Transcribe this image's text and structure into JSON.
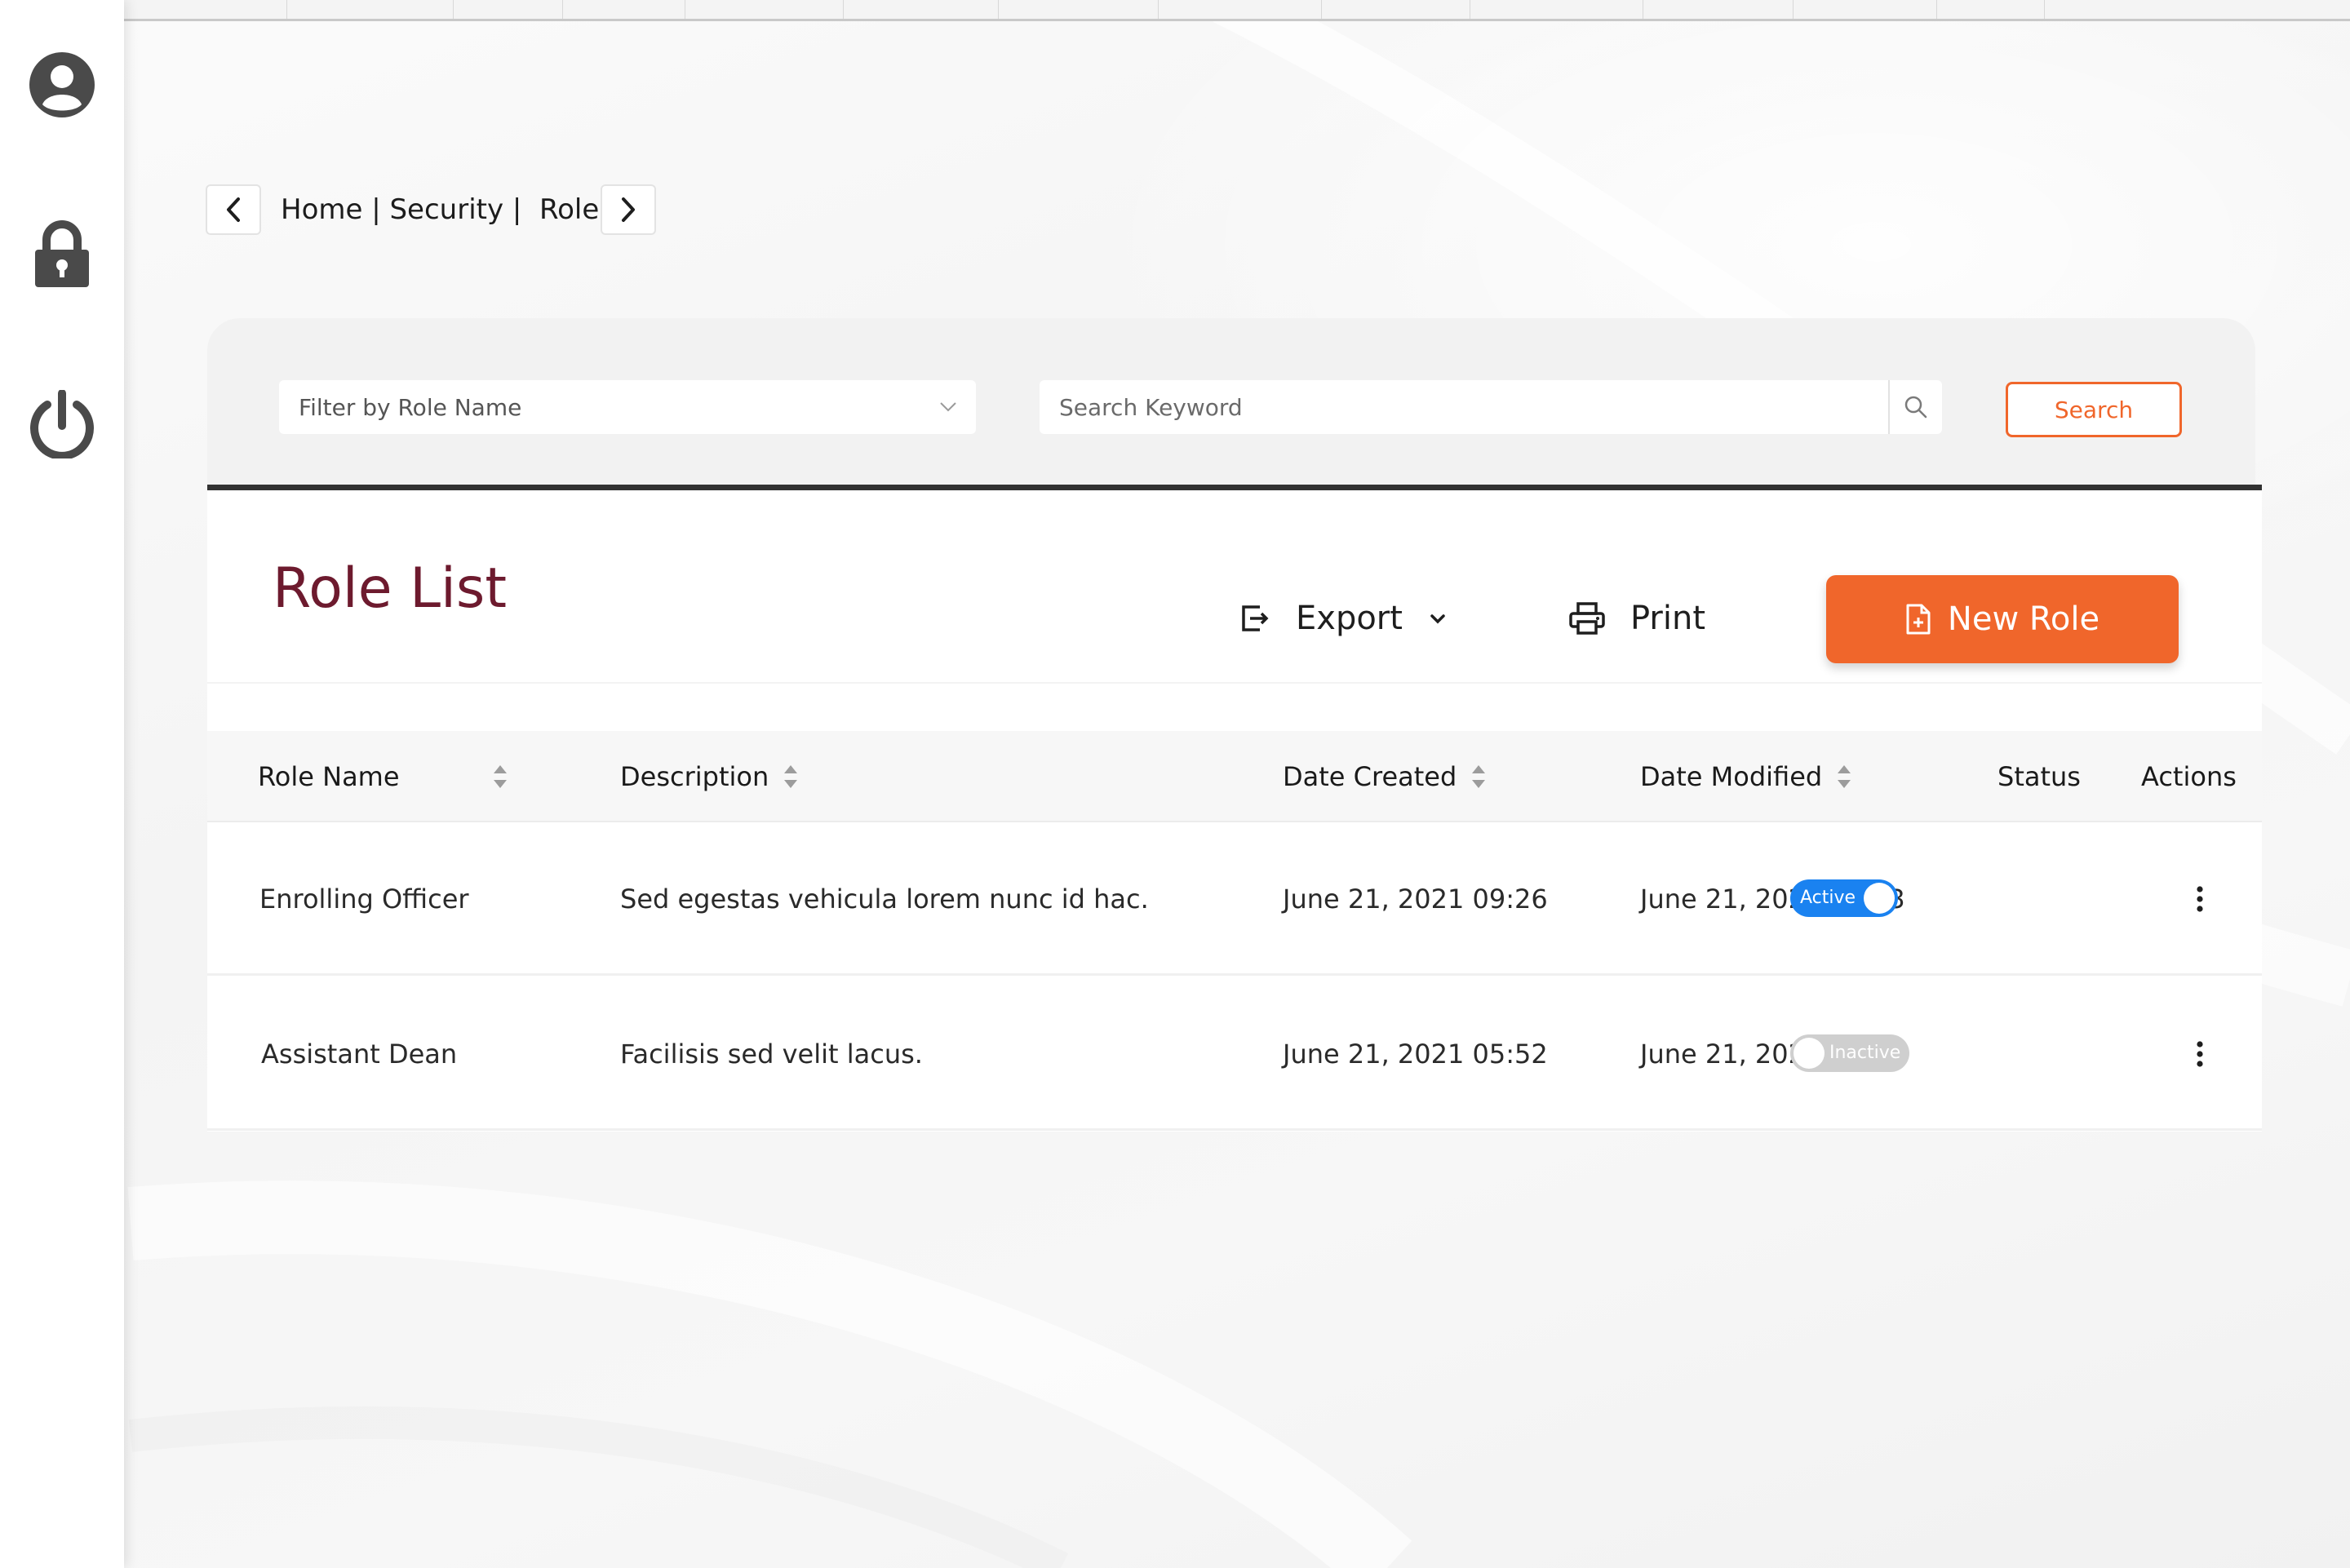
{
  "sidebar": {
    "items": [
      {
        "icon": "user-circle-icon"
      },
      {
        "icon": "lock-icon"
      },
      {
        "icon": "power-icon"
      }
    ]
  },
  "breadcrumb": {
    "text": "Home | Security |  Roles"
  },
  "filter": {
    "role_filter_value": "Filter by  Role Name",
    "search_placeholder": "Search Keyword",
    "search_button": "Search"
  },
  "list": {
    "title": "Role List",
    "export_label": "Export",
    "print_label": "Print",
    "new_button_label": "New Role"
  },
  "table": {
    "columns": [
      "Role Name",
      "Description",
      "Date Created",
      "Date Modified",
      "Status",
      "Actions"
    ],
    "rows": [
      {
        "role_name": "Enrolling Officer",
        "description": "Sed egestas vehicula lorem nunc id hac.",
        "date_created": "June 21, 2021 09:26",
        "date_modified": "June 21, 2021 16:43",
        "status": "Active"
      },
      {
        "role_name": "Assistant Dean",
        "description": "Facilisis sed velit lacus.",
        "date_created": "June 21, 2021 05:52",
        "date_modified": "June 21, 2021 23:15",
        "status": "Inactive"
      }
    ]
  },
  "colors": {
    "accent": "#f0662b",
    "title": "#6d1a2e",
    "toggle_active": "#1a82f0",
    "toggle_inactive": "#cfcfcf",
    "sidebar_icon": "#4a4a4a"
  }
}
